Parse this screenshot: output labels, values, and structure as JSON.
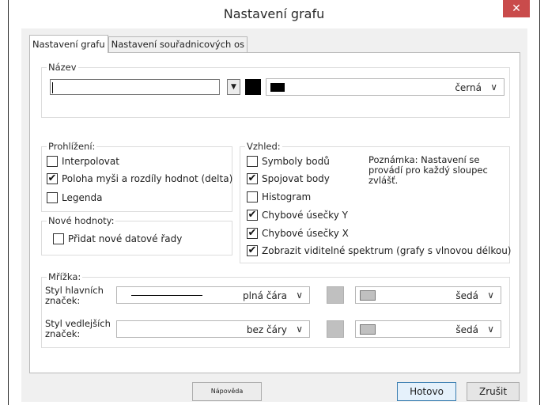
{
  "window": {
    "title": "Nastavení grafu",
    "close_glyph": "✕"
  },
  "tabs": [
    {
      "label": "Nastavení grafu",
      "active": true
    },
    {
      "label": "Nastavení souřadnicových os",
      "active": false
    }
  ],
  "name_group": {
    "title": "Název",
    "name_value": "",
    "font_color_label": "černá",
    "font_color_hex": "#000000"
  },
  "view_group": {
    "title": "Prohlížení:",
    "items": [
      {
        "label": "Interpolovat",
        "checked": false
      },
      {
        "label": "Poloha myši a rozdíly hodnot (delta)",
        "checked": true
      },
      {
        "label": "Legenda",
        "checked": false
      }
    ]
  },
  "new_values_group": {
    "title": "Nové hodnoty:",
    "items": [
      {
        "label": "Přidat nové datové řady",
        "checked": false
      }
    ]
  },
  "appearance_group": {
    "title": "Vzhled:",
    "items": [
      {
        "label": "Symboly bodů",
        "checked": false
      },
      {
        "label": "Spojovat body",
        "checked": true
      },
      {
        "label": "Histogram",
        "checked": false
      },
      {
        "label": "Chybové úsečky Y",
        "checked": true
      },
      {
        "label": "Chybové úsečky X",
        "checked": true
      },
      {
        "label": "Zobrazit viditelné spektrum (grafy s vlnovou délkou)",
        "checked": true
      }
    ],
    "note_line1": "Poznámka: Nastavení se",
    "note_line2": "provádí pro každý sloupec",
    "note_line3": "zvlášť."
  },
  "grid_group": {
    "title": "Mřížka:",
    "major": {
      "label_line1": "Styl hlavních",
      "label_line2": "značek:",
      "style_value": "plná čára",
      "color_label": "šedá",
      "color_hex": "#c0c0c0"
    },
    "minor": {
      "label_line1": "Styl vedlejších",
      "label_line2": "značek:",
      "style_value": "bez čáry",
      "color_label": "šedá",
      "color_hex": "#c0c0c0"
    }
  },
  "buttons": {
    "help": "Nápověda",
    "ok": "Hotovo",
    "cancel": "Zrušit"
  },
  "icons": {
    "chevron": "∨",
    "dropdown_arrow": "▼",
    "check": "✔"
  }
}
